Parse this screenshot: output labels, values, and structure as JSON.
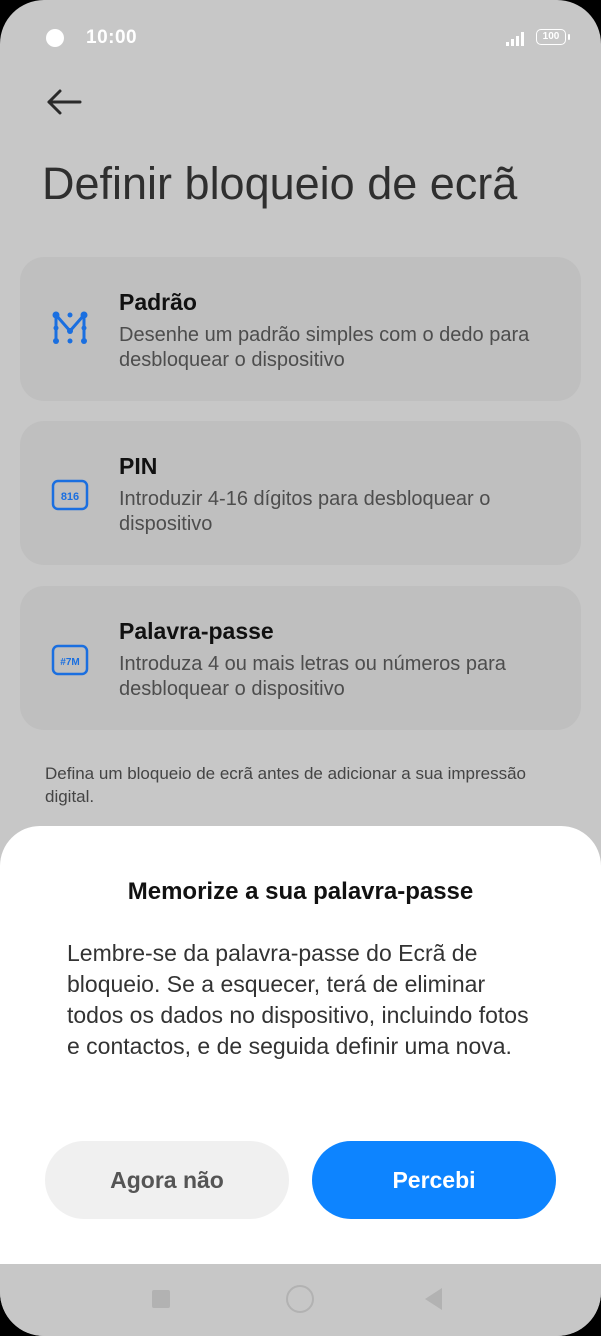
{
  "status_bar": {
    "time": "10:00",
    "battery": "100",
    "icons": [
      "notification-dot-icon",
      "signal-icon",
      "battery-icon"
    ]
  },
  "header": {
    "back_icon": "arrow-left-icon",
    "title": "Definir bloqueio de ecrã"
  },
  "options": [
    {
      "icon": "pattern-icon",
      "title": "Padrão",
      "description": "Desenhe um padrão simples com o dedo para desbloquear o dispositivo"
    },
    {
      "icon": "pin-icon",
      "icon_text": "816",
      "title": "PIN",
      "description": "Introduzir 4-16 dígitos para desbloquear o dispositivo"
    },
    {
      "icon": "password-icon",
      "icon_text": "#7M",
      "title": "Palavra-passe",
      "description": "Introduza 4 ou mais letras ou números para desbloquear o dispositivo"
    }
  ],
  "note": "Defina um bloqueio de ecrã antes de adicionar a sua impressão digital.",
  "dialog": {
    "title": "Memorize a sua palavra-passe",
    "body": "Lembre-se da palavra-passe do Ecrã de bloqueio. Se a esquecer, terá de eliminar todos os dados no dispositivo, incluindo fotos e contactos, e de seguida definir uma nova.",
    "secondary_button": "Agora não",
    "primary_button": "Percebi"
  },
  "nav_bar": {
    "icons": [
      "recents-square-icon",
      "home-circle-icon",
      "back-triangle-icon"
    ]
  },
  "colors": {
    "accent": "#0d84ff",
    "icon_blue": "#1a6fe0",
    "dim_background": "#c7c7c7",
    "card": "#bfbfbf"
  }
}
